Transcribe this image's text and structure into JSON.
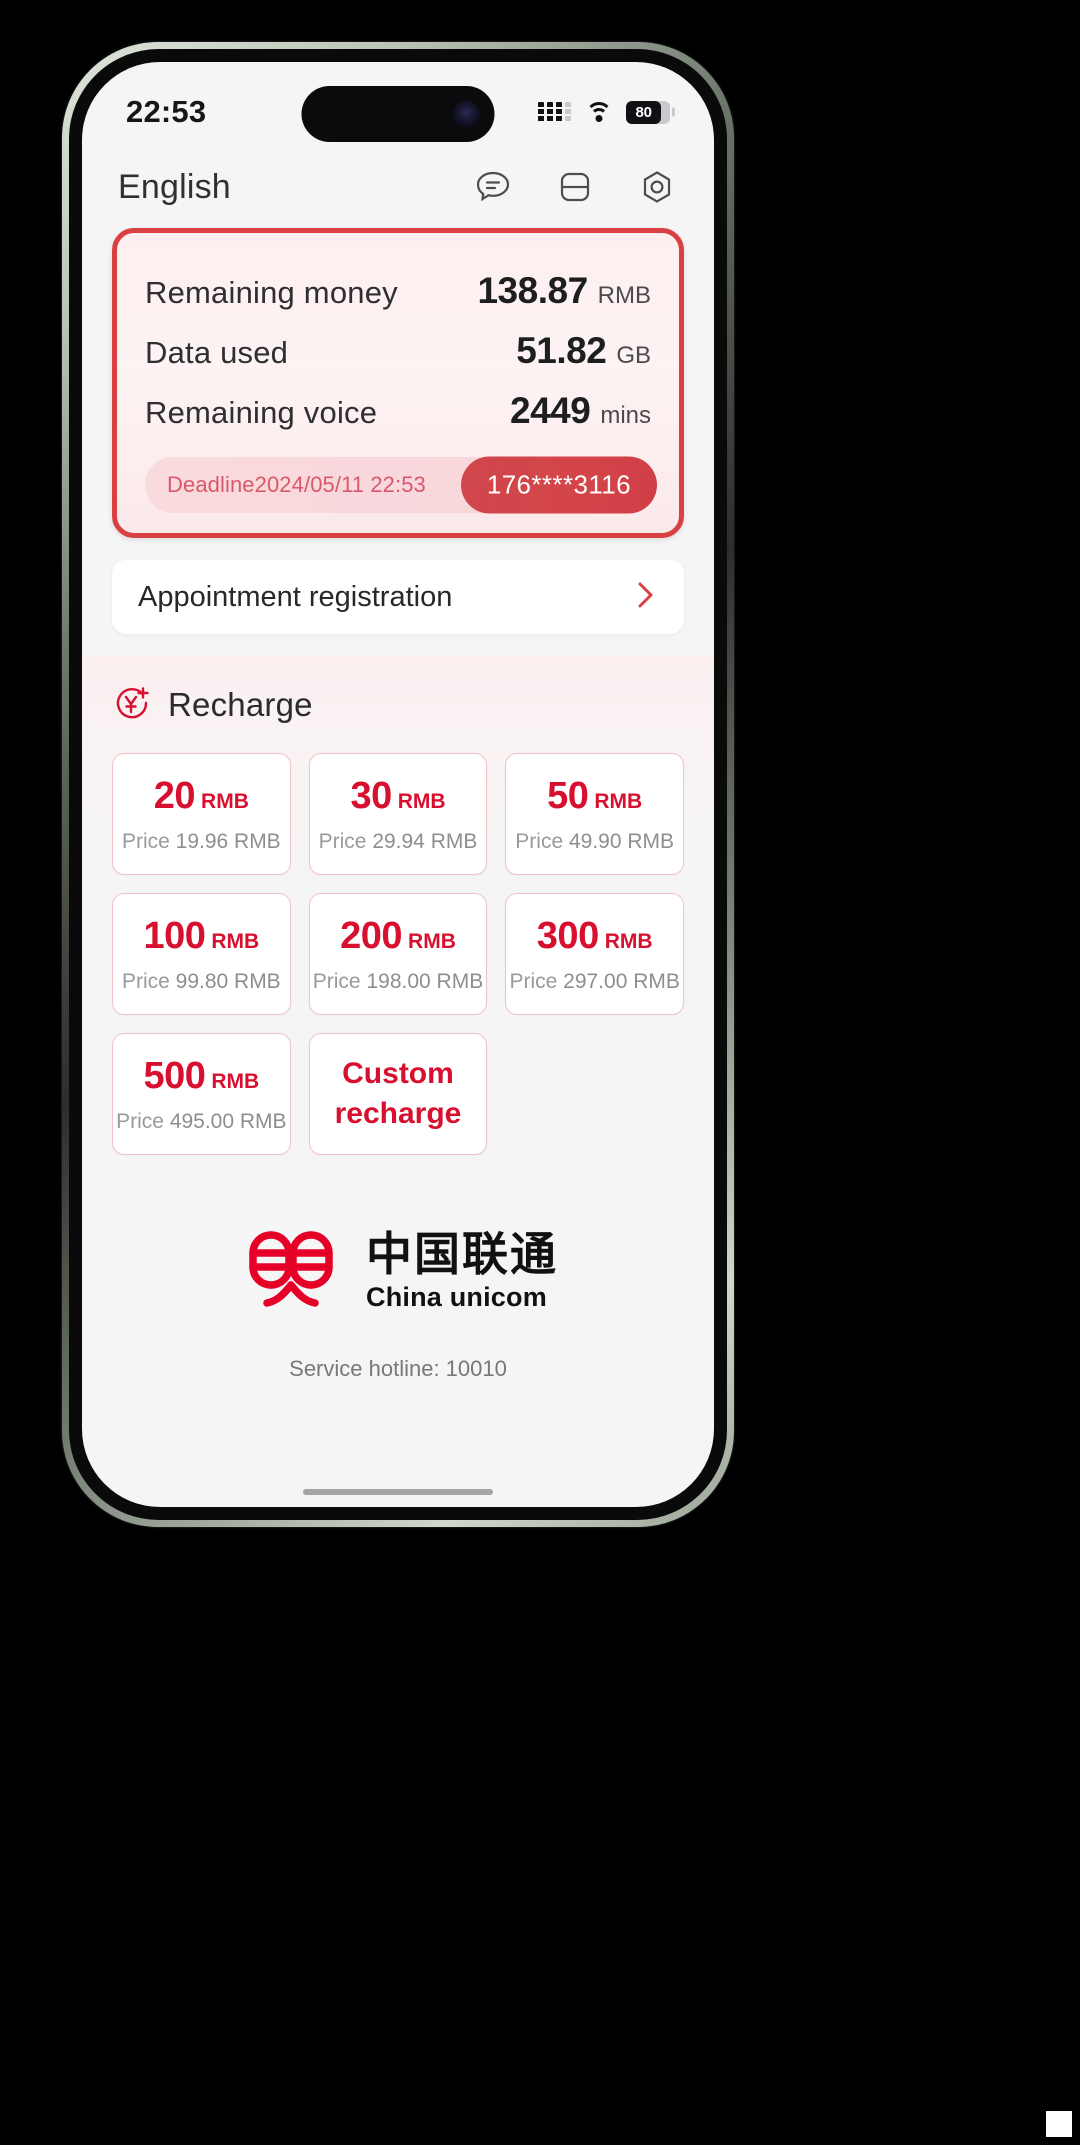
{
  "status_bar": {
    "time": "22:53",
    "battery_percent": "80",
    "signal_icon": "signal-bars-icon",
    "wifi_icon": "wifi-icon",
    "battery_icon": "battery-icon"
  },
  "header": {
    "language": "English",
    "icons": [
      {
        "name": "chat-icon",
        "label": "Chat"
      },
      {
        "name": "service-list-icon",
        "label": "Services"
      },
      {
        "name": "settings-hexagon-icon",
        "label": "Settings"
      }
    ]
  },
  "balance_card": {
    "accent_color": "#d94044",
    "rows": [
      {
        "label": "Remaining money",
        "value": "138.87",
        "unit": "RMB"
      },
      {
        "label": "Data used",
        "value": "51.82",
        "unit": "GB"
      },
      {
        "label": "Remaining voice",
        "value": "2449",
        "unit": "mins"
      }
    ],
    "deadline": "Deadline2024/05/11 22:53",
    "phone_number": "176****3116"
  },
  "appointment": {
    "label": "Appointment registration",
    "chevron_icon": "chevron-right-icon"
  },
  "recharge": {
    "icon": "recharge-yuan-plus-icon",
    "title": "Recharge",
    "accent_color": "#d8102f",
    "tiles": [
      {
        "amount": "20",
        "currency": "RMB",
        "price_label": "Price",
        "price": "19.96 RMB"
      },
      {
        "amount": "30",
        "currency": "RMB",
        "price_label": "Price",
        "price": "29.94 RMB"
      },
      {
        "amount": "50",
        "currency": "RMB",
        "price_label": "Price",
        "price": "49.90 RMB"
      },
      {
        "amount": "100",
        "currency": "RMB",
        "price_label": "Price",
        "price": "99.80 RMB"
      },
      {
        "amount": "200",
        "currency": "RMB",
        "price_label": "Price",
        "price": "198.00 RMB"
      },
      {
        "amount": "300",
        "currency": "RMB",
        "price_label": "Price",
        "price": "297.00 RMB"
      },
      {
        "amount": "500",
        "currency": "RMB",
        "price_label": "Price",
        "price": "495.00 RMB"
      }
    ],
    "custom_tile": {
      "line1": "Custom",
      "line2": "recharge"
    }
  },
  "footer": {
    "logo_cn": "中国联通",
    "logo_en": "China unicom",
    "logo_icon": "china-unicom-knot-icon",
    "hotline": "Service hotline: 10010"
  }
}
